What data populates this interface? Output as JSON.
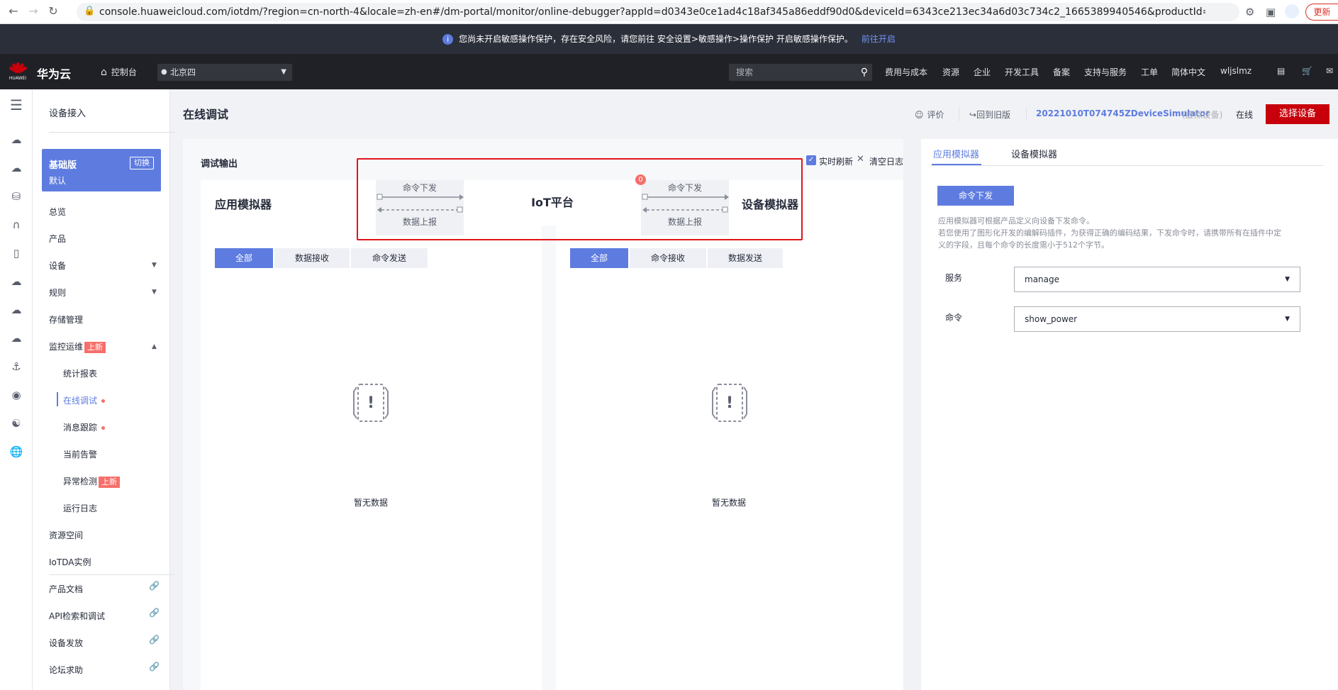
{
  "browser": {
    "url": "console.huaweicloud.com/iotdm/?region=cn-north-4&locale=zh-en#/dm-portal/monitor/online-debugger?appId=d0343e0ce1ad4c18af345a86eddf90d0&deviceId=6343ce213ec34a6d03c734c2_1665389940546&productId=6...",
    "update_label": "更新"
  },
  "notice": {
    "text": "您尚未开启敏感操作保护，存在安全风险，请您前往 安全设置>敏感操作>操作保护 开启敏感操作保护。",
    "link": "前往开启"
  },
  "header": {
    "logo_text": "HUAWEI",
    "brand": "华为云",
    "console": "控制台",
    "region": "北京四",
    "search_placeholder": "搜索",
    "nav": [
      "费用与成本",
      "资源",
      "企业",
      "开发工具",
      "备案",
      "支持与服务",
      "工单",
      "简体中文",
      "wljslmz"
    ]
  },
  "sidebar": {
    "title": "设备接入",
    "edition": {
      "name": "基础版",
      "sub": "默认",
      "switch": "切换"
    },
    "items": {
      "overview": "总览",
      "product": "产品",
      "device": "设备",
      "rules": "规则",
      "storage": "存储管理",
      "monitor": "监控运维",
      "monitor_badge": "上新",
      "stats": "统计报表",
      "online_debug": "在线调试",
      "msg_trace": "消息跟踪",
      "alarms": "当前告警",
      "anomaly": "异常检测",
      "anomaly_badge": "上新",
      "run_log": "运行日志",
      "resource_space": "资源空间",
      "iotda": "IoTDA实例",
      "docs": "产品文档",
      "api": "API检索和调试",
      "provision": "设备发放",
      "forum": "论坛求助"
    }
  },
  "page": {
    "title": "在线调试",
    "rate": "评价",
    "back_old": "回到旧版",
    "device_name": "20221010T074745ZDeviceSimulator",
    "device_tag": "(虚拟设备)",
    "status": "在线",
    "select_device": "选择设备"
  },
  "debug": {
    "title": "调试输出",
    "realtime": "实时刷新",
    "clear": "清空日志",
    "app_sim": "应用模拟器",
    "iot_platform": "IoT平台",
    "device_sim": "设备模拟器",
    "cmd_down": "命令下发",
    "data_up": "数据上报",
    "badge_count": "0",
    "left_tabs": [
      "全部",
      "数据接收",
      "命令发送"
    ],
    "right_tabs": [
      "全部",
      "命令接收",
      "数据发送"
    ],
    "empty": "暂无数据"
  },
  "right": {
    "tabs": [
      "应用模拟器",
      "设备模拟器"
    ],
    "cmd_button": "命令下发",
    "desc1": "应用模拟器可根据产品定义向设备下发命令。",
    "desc2": "若您使用了图形化开发的编解码插件，为获得正确的编码结果，下发命令时，请携带所有在插件中定",
    "desc3": "义的字段，且每个命令的长度需小于512个字节。",
    "service_label": "服务",
    "service_value": "manage",
    "command_label": "命令",
    "command_value": "show_power"
  },
  "colors": {
    "accent": "#5e7ce0",
    "brand_red": "#c7000b",
    "badge": "#f66f6a"
  }
}
